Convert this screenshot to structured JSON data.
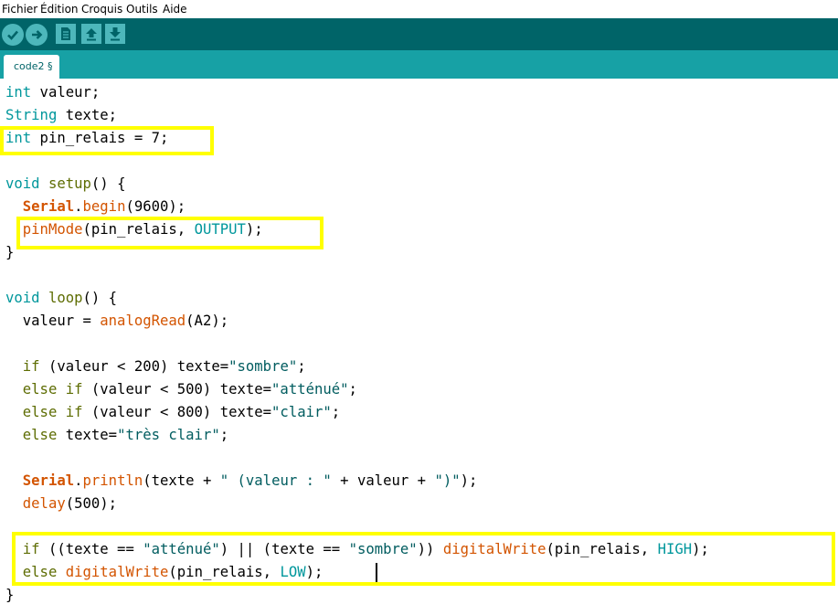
{
  "menu": [
    "Fichier",
    "Édition",
    "Croquis",
    "Outils",
    "Aide"
  ],
  "toolbar": {
    "buttons": [
      "verify-icon",
      "upload-icon",
      "new-icon",
      "open-icon",
      "save-icon"
    ]
  },
  "tab": {
    "label": "code2 §"
  },
  "code": {
    "line1": {
      "kw": "int",
      "rest": " valeur;"
    },
    "line2": {
      "kw": "String",
      "rest": " texte;"
    },
    "line3": {
      "kw": "int",
      "rest": " pin_relais = 7;"
    },
    "line5": {
      "kw": "void",
      "fn": " setup",
      "rest": "() {"
    },
    "line6": {
      "indent": "  ",
      "obj": "Serial",
      "dot": ".",
      "fn": "begin",
      "rest": "(9600);"
    },
    "line7": {
      "indent": "  ",
      "fn": "pinMode",
      "a": "(pin_relais, ",
      "const": "OUTPUT",
      "b": ");"
    },
    "line8": "}",
    "line10": {
      "kw": "void",
      "fn": " loop",
      "rest": "() {"
    },
    "line11": {
      "a": "  valeur = ",
      "fn": "analogRead",
      "b": "(A2);"
    },
    "line13": {
      "indent": "  ",
      "kw": "if",
      "a": " (valeur < 200) texte=",
      "s": "\"sombre\"",
      "b": ";"
    },
    "line14": {
      "indent": "  ",
      "kw": "else if",
      "a": " (valeur < 500) texte=",
      "s": "\"atténué\"",
      "b": ";"
    },
    "line15": {
      "indent": "  ",
      "kw": "else if",
      "a": " (valeur < 800) texte=",
      "s": "\"clair\"",
      "b": ";"
    },
    "line16": {
      "indent": "  ",
      "kw": "else",
      "a": " texte=",
      "s": "\"très clair\"",
      "b": ";"
    },
    "line18": {
      "indent": "  ",
      "obj": "Serial",
      "dot": ".",
      "fn": "println",
      "a": "(texte + ",
      "s": "\" (valeur : \"",
      "b": " + valeur + ",
      "s2": "\")\"",
      "c": ");"
    },
    "line19": {
      "indent": "  ",
      "fn": "delay",
      "a": "(500);"
    },
    "line21": {
      "indent": "  ",
      "kw": "if",
      "a": " ((texte == ",
      "s": "\"atténué\"",
      "b": ") || (texte == ",
      "s2": "\"sombre\"",
      "c": ")) ",
      "fn": "digitalWrite",
      "d": "(pin_relais, ",
      "const": "HIGH",
      "e": ");"
    },
    "line22": {
      "indent": "  ",
      "kw": "else",
      "a": " ",
      "fn": "digitalWrite",
      "b": "(pin_relais, ",
      "const": "LOW",
      "c": ");"
    },
    "line23": "}"
  },
  "colors": {
    "toolbar": "#006468",
    "tabbar": "#17a1a5",
    "highlight": "#ffff00"
  }
}
